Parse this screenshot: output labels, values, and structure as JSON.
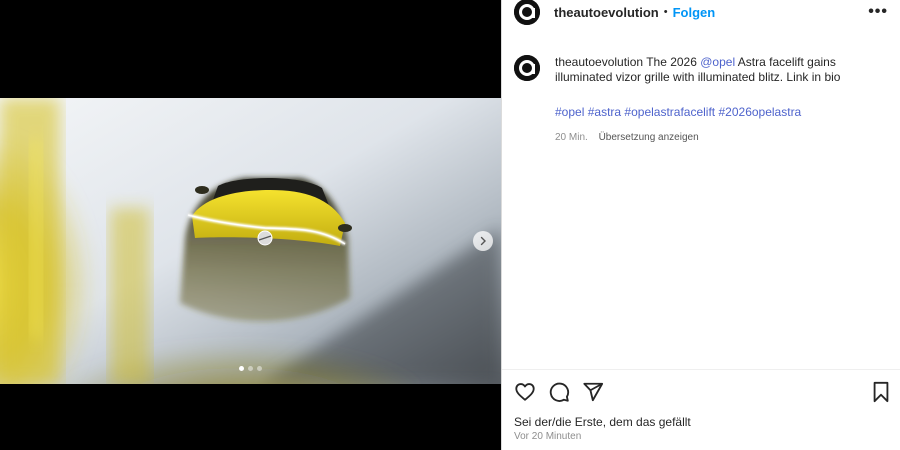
{
  "header": {
    "username": "theautoevolution",
    "avatar_letter": "a",
    "separator": "•",
    "follow_label": "Folgen",
    "more_label": "•••"
  },
  "caption": {
    "username": "theautoevolution",
    "text_before_mention": " The 2026 ",
    "mention": "@opel",
    "text_after_mention": " Astra facelift gains illuminated vizor grille with illuminated blitz. Link in bio",
    "hashtags": [
      "#opel",
      "#astra",
      "#opelastrafacelift",
      "#2026opelastra"
    ],
    "time": "20 Min.",
    "translate_label": "Übersetzung anzeigen"
  },
  "media": {
    "carousel_dots": 3,
    "active_dot": 0,
    "next_icon": "chevron-right-icon"
  },
  "actions": {
    "icons": [
      "heart-icon",
      "comment-icon",
      "share-icon",
      "bookmark-icon"
    ]
  },
  "likes_text": "Sei der/die Erste, dem das gefällt",
  "timestamp": "Vor 20 Minuten",
  "colors": {
    "follow_blue": "#0095f6",
    "link_blue": "#4e63cc",
    "car_yellow": "#e3d21a"
  }
}
